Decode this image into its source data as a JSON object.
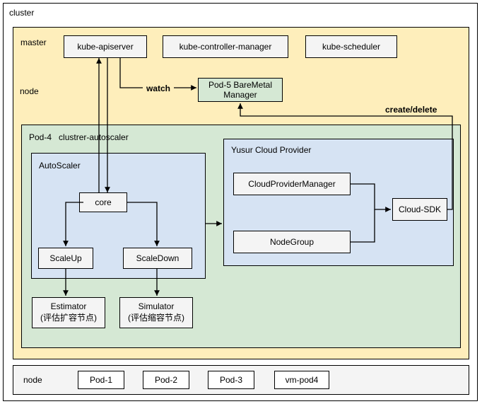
{
  "cluster": {
    "label": "cluster",
    "master": {
      "label": "master",
      "kube_apiserver": "kube-apiserver",
      "kube_controller_manager": "kube-controller-manager",
      "kube_scheduler": "kube-scheduler"
    },
    "node_upper": {
      "label": "node",
      "watch_label": "watch",
      "pod5": "Pod-5 BareMetal\nManager",
      "create_delete_label": "create/delete",
      "pod4": {
        "label": "Pod-4   clustrer-autoscaler",
        "autoscaler": {
          "label": "AutoScaler",
          "core": "core",
          "scaleup": "ScaleUp",
          "scaledown": "ScaleDown"
        },
        "estimator": "Estimator\n(评估扩容节点)",
        "simulator": "Simulator\n(评估缩容节点)",
        "provider": {
          "label": "Yusur Cloud Provider",
          "cloud_provider_manager": "CloudProviderManager",
          "node_group": "NodeGroup",
          "cloud_sdk": "Cloud-SDK"
        }
      }
    },
    "node_lower": {
      "label": "node",
      "pod1": "Pod-1",
      "pod2": "Pod-2",
      "pod3": "Pod-3",
      "vmpod4": "vm-pod4"
    }
  }
}
